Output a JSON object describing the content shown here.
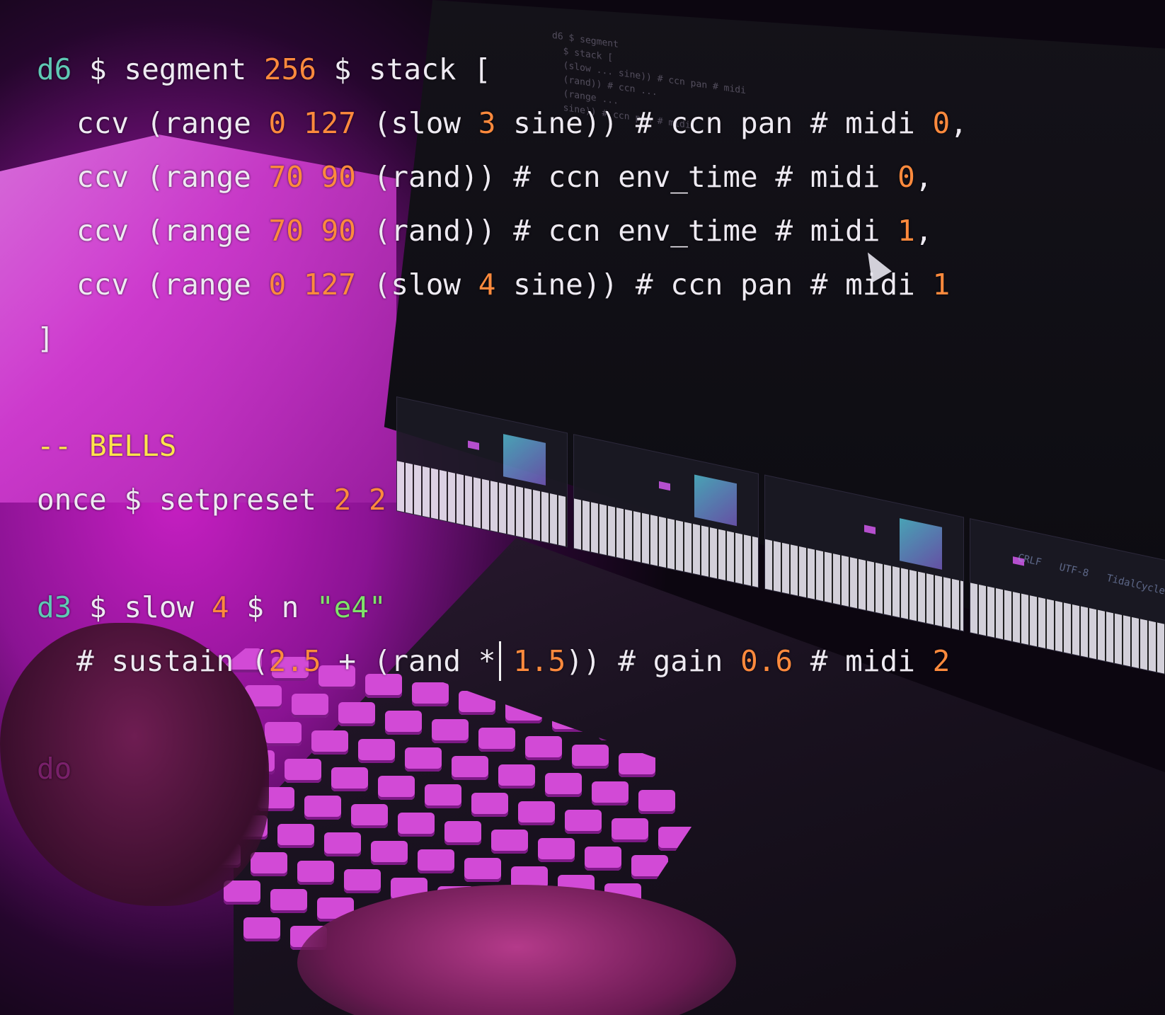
{
  "editor": {
    "lines": [
      {
        "id": "l1",
        "tokens": [
          {
            "t": "d6",
            "c": "kw"
          },
          {
            "t": " $ segment ",
            "c": ""
          },
          {
            "t": "256",
            "c": "num"
          },
          {
            "t": " $ stack [",
            "c": ""
          }
        ]
      },
      {
        "id": "l2",
        "indent": true,
        "tokens": [
          {
            "t": "ccv (range ",
            "c": ""
          },
          {
            "t": "0 127",
            "c": "num"
          },
          {
            "t": " (slow ",
            "c": ""
          },
          {
            "t": "3",
            "c": "num"
          },
          {
            "t": " sine)) # ccn pan # midi ",
            "c": ""
          },
          {
            "t": "0",
            "c": "num"
          },
          {
            "t": ",",
            "c": ""
          }
        ]
      },
      {
        "id": "l3",
        "indent": true,
        "tokens": [
          {
            "t": "ccv (range ",
            "c": ""
          },
          {
            "t": "70 90",
            "c": "num"
          },
          {
            "t": " (rand)) # ccn env_time # midi ",
            "c": ""
          },
          {
            "t": "0",
            "c": "num"
          },
          {
            "t": ",",
            "c": ""
          }
        ]
      },
      {
        "id": "l4",
        "indent": true,
        "tokens": [
          {
            "t": "ccv (range ",
            "c": ""
          },
          {
            "t": "70 90",
            "c": "num"
          },
          {
            "t": " (rand)) # ccn env_time # midi ",
            "c": ""
          },
          {
            "t": "1",
            "c": "num"
          },
          {
            "t": ",",
            "c": ""
          }
        ]
      },
      {
        "id": "l5",
        "indent": true,
        "tokens": [
          {
            "t": "ccv (range ",
            "c": ""
          },
          {
            "t": "0 127",
            "c": "num"
          },
          {
            "t": " (slow ",
            "c": ""
          },
          {
            "t": "4",
            "c": "num"
          },
          {
            "t": " sine)) # ccn pan # midi ",
            "c": ""
          },
          {
            "t": "1",
            "c": "num"
          }
        ]
      },
      {
        "id": "l6",
        "tokens": [
          {
            "t": "]",
            "c": ""
          }
        ]
      },
      {
        "id": "l7",
        "tokens": []
      },
      {
        "id": "l8",
        "tokens": [
          {
            "t": "-- BELLS",
            "c": "cm"
          }
        ]
      },
      {
        "id": "l9",
        "tokens": [
          {
            "t": "once $ setpreset ",
            "c": ""
          },
          {
            "t": "2 2",
            "c": "num"
          }
        ]
      },
      {
        "id": "l10",
        "tokens": []
      },
      {
        "id": "l11",
        "tokens": [
          {
            "t": "d3",
            "c": "kw"
          },
          {
            "t": " $ slow ",
            "c": ""
          },
          {
            "t": "4",
            "c": "num"
          },
          {
            "t": " $ n ",
            "c": ""
          },
          {
            "t": "\"e4\"",
            "c": "str"
          }
        ]
      },
      {
        "id": "l12",
        "indent": true,
        "tokens": [
          {
            "t": "# sustain (",
            "c": ""
          },
          {
            "t": "2.5",
            "c": "num"
          },
          {
            "t": " + (rand * ",
            "c": ""
          },
          {
            "t": "1.5",
            "c": "num"
          },
          {
            "t": ")) # gain ",
            "c": ""
          },
          {
            "t": "0.6",
            "c": "num"
          },
          {
            "t": " # midi ",
            "c": ""
          },
          {
            "t": "2",
            "c": "num"
          }
        ]
      },
      {
        "id": "l13",
        "tokens": []
      },
      {
        "id": "l14",
        "tokens": [
          {
            "t": "do",
            "c": "faint"
          }
        ]
      }
    ]
  },
  "status_bar": [
    "CRLF",
    "UTF-8",
    "TidalCycles"
  ],
  "colors": {
    "accent": "#d640d5",
    "number": "#ff8a3d",
    "keyword": "#5fc9b5",
    "string": "#7fe36a",
    "comment": "#ffe44c"
  }
}
